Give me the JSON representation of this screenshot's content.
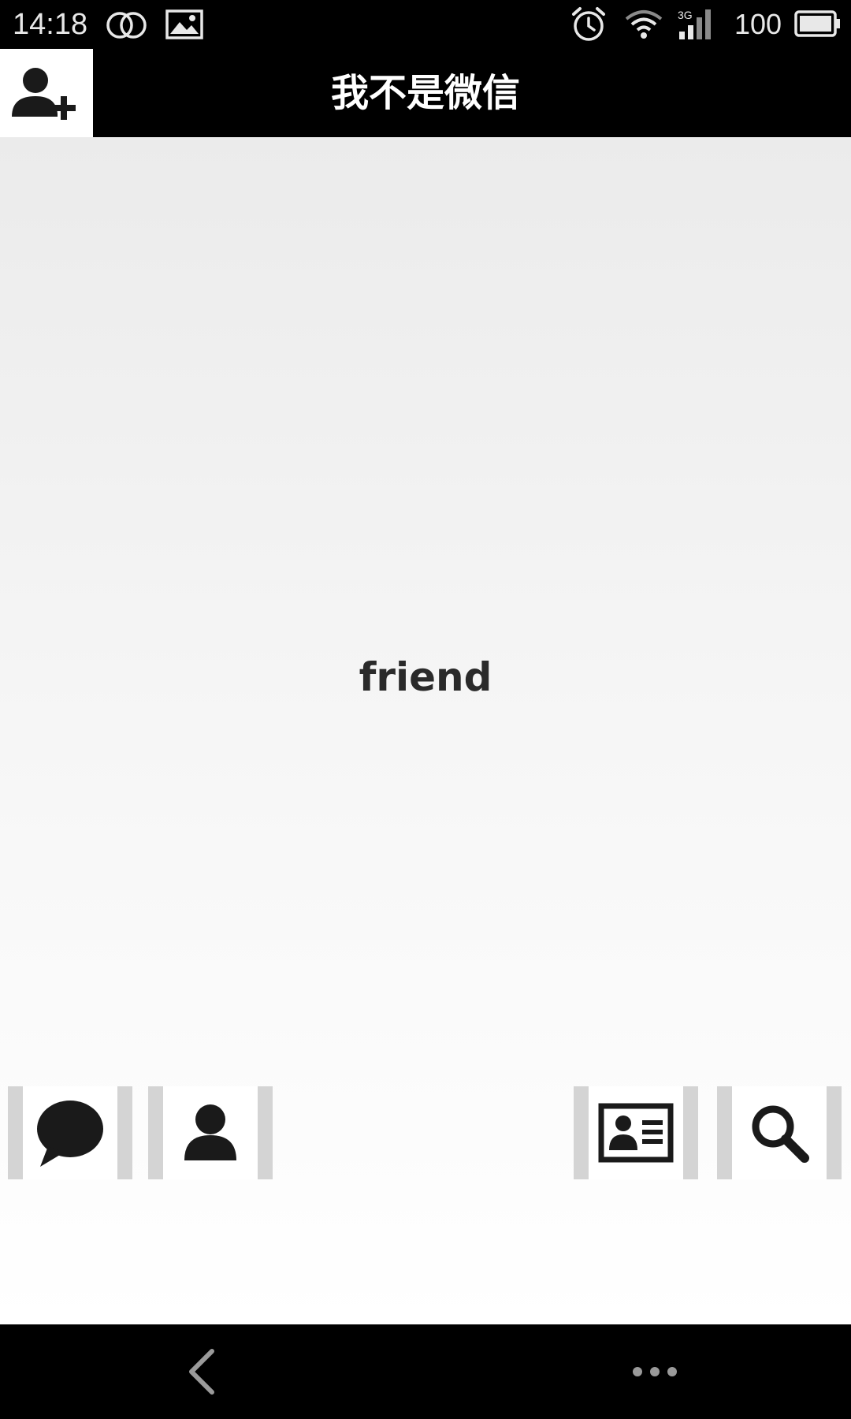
{
  "status_bar": {
    "time": "14:18",
    "battery": "100",
    "icons": [
      "circles-icon",
      "image-icon",
      "alarm-icon",
      "wifi-icon",
      "signal-3g-icon",
      "battery-icon"
    ]
  },
  "header": {
    "title": "我不是微信",
    "left_button_icon": "add-friend-icon"
  },
  "content": {
    "label": "friend"
  },
  "tabs": [
    {
      "icon": "chat-bubble-icon"
    },
    {
      "icon": "person-icon"
    },
    {
      "icon": "contact-card-icon"
    },
    {
      "icon": "search-icon"
    }
  ],
  "nav": {
    "icons": [
      "back-icon",
      "more-icon"
    ]
  },
  "colors": {
    "bar": "#000000",
    "title_text": "#ffffff",
    "content_top": "#ebebeb",
    "content_bottom": "#ffffff",
    "tab_border": "#d4d4d4",
    "icon_dark": "#1a1a1a"
  }
}
